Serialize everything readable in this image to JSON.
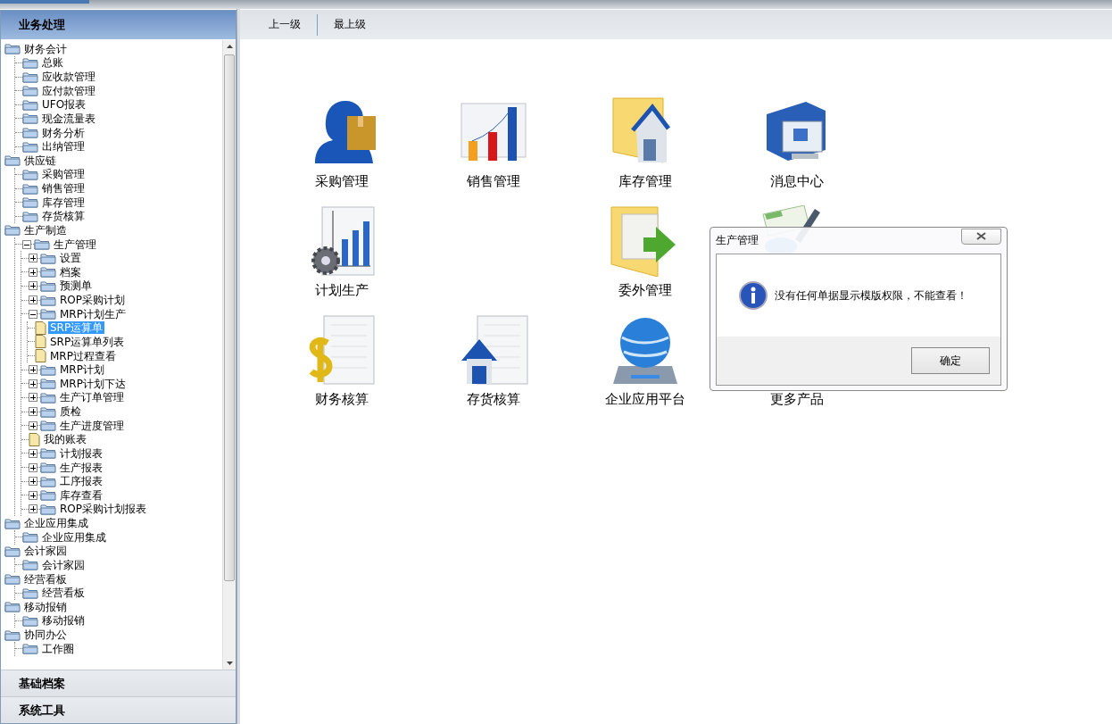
{
  "sidebar": {
    "title": "业务处理",
    "tree": [
      {
        "label": "财务会计",
        "kind": "folder",
        "selected": false,
        "children": [
          {
            "label": "总账",
            "kind": "folder",
            "selected": false
          },
          {
            "label": "应收款管理",
            "kind": "folder",
            "selected": false
          },
          {
            "label": "应付款管理",
            "kind": "folder",
            "selected": false
          },
          {
            "label": "UFO报表",
            "kind": "folder",
            "selected": false
          },
          {
            "label": "现金流量表",
            "kind": "folder",
            "selected": false
          },
          {
            "label": "财务分析",
            "kind": "folder",
            "selected": false
          },
          {
            "label": "出纳管理",
            "kind": "folder",
            "selected": false
          }
        ]
      },
      {
        "label": "供应链",
        "kind": "folder",
        "selected": false,
        "children": [
          {
            "label": "采购管理",
            "kind": "folder",
            "selected": false
          },
          {
            "label": "销售管理",
            "kind": "folder",
            "selected": false
          },
          {
            "label": "库存管理",
            "kind": "folder",
            "selected": false
          },
          {
            "label": "存货核算",
            "kind": "folder",
            "selected": false
          }
        ]
      },
      {
        "label": "生产制造",
        "kind": "folder",
        "selected": false,
        "children": [
          {
            "label": "生产管理",
            "kind": "folder",
            "selected": false,
            "expanded": true,
            "children": [
              {
                "label": "设置",
                "kind": "folder",
                "selected": false,
                "expanded": false
              },
              {
                "label": "档案",
                "kind": "folder",
                "selected": false,
                "expanded": false
              },
              {
                "label": "预测单",
                "kind": "folder",
                "selected": false,
                "expanded": false
              },
              {
                "label": "ROP采购计划",
                "kind": "folder",
                "selected": false,
                "expanded": false
              },
              {
                "label": "MRP计划生产",
                "kind": "folder",
                "selected": false,
                "expanded": true,
                "children": [
                  {
                    "label": "SRP运算单",
                    "kind": "file",
                    "selected": true
                  },
                  {
                    "label": "SRP运算单列表",
                    "kind": "file",
                    "selected": false
                  },
                  {
                    "label": "MRP过程查看",
                    "kind": "file",
                    "selected": false
                  }
                ]
              },
              {
                "label": "MRP计划",
                "kind": "folder",
                "selected": false,
                "expanded": false
              },
              {
                "label": "MRP计划下达",
                "kind": "folder",
                "selected": false,
                "expanded": false
              },
              {
                "label": "生产订单管理",
                "kind": "folder",
                "selected": false,
                "expanded": false
              },
              {
                "label": "质检",
                "kind": "folder",
                "selected": false,
                "expanded": false
              },
              {
                "label": "生产进度管理",
                "kind": "folder",
                "selected": false,
                "expanded": false
              },
              {
                "label": "我的账表",
                "kind": "file",
                "selected": false
              },
              {
                "label": "计划报表",
                "kind": "folder",
                "selected": false,
                "expanded": false
              },
              {
                "label": "生产报表",
                "kind": "folder",
                "selected": false,
                "expanded": false
              },
              {
                "label": "工序报表",
                "kind": "folder",
                "selected": false,
                "expanded": false
              },
              {
                "label": "库存查看",
                "kind": "folder",
                "selected": false,
                "expanded": false
              },
              {
                "label": "ROP采购计划报表",
                "kind": "folder",
                "selected": false,
                "expanded": false
              }
            ]
          }
        ]
      },
      {
        "label": "企业应用集成",
        "kind": "folder",
        "selected": false,
        "children": [
          {
            "label": "企业应用集成",
            "kind": "folder",
            "selected": false
          }
        ]
      },
      {
        "label": "会计家园",
        "kind": "folder",
        "selected": false,
        "children": [
          {
            "label": "会计家园",
            "kind": "folder",
            "selected": false
          }
        ]
      },
      {
        "label": "经营看板",
        "kind": "folder",
        "selected": false,
        "children": [
          {
            "label": "经营看板",
            "kind": "folder",
            "selected": false
          }
        ]
      },
      {
        "label": "移动报销",
        "kind": "folder",
        "selected": false,
        "children": [
          {
            "label": "移动报销",
            "kind": "folder",
            "selected": false
          }
        ]
      },
      {
        "label": "协同办公",
        "kind": "folder",
        "selected": false,
        "children": [
          {
            "label": "工作圈",
            "kind": "folder",
            "selected": false
          }
        ]
      }
    ],
    "sections": [
      "基础档案",
      "系统工具"
    ]
  },
  "toolbar": {
    "buttons": [
      "上一级",
      "最上级"
    ]
  },
  "modules": [
    {
      "kind": "tile",
      "label": "采购管理"
    },
    {
      "kind": "tile",
      "label": "销售管理"
    },
    {
      "kind": "tile",
      "label": "库存管理"
    },
    {
      "kind": "tile",
      "label": "消息中心"
    },
    {
      "kind": "tile",
      "label": "计划生产"
    },
    {
      "kind": "empty"
    },
    {
      "kind": "tile",
      "label": "委外管理"
    },
    {
      "kind": "tile"
    },
    {
      "kind": "tile",
      "label": "财务核算"
    },
    {
      "kind": "tile",
      "label": "存货核算"
    },
    {
      "kind": "tile",
      "label": "企业应用平台"
    },
    {
      "kind": "tile",
      "label": "更多产品"
    }
  ],
  "dialog": {
    "title": "生产管理",
    "message": "没有任何单据显示模版权限，不能查看！",
    "button": "确定"
  }
}
